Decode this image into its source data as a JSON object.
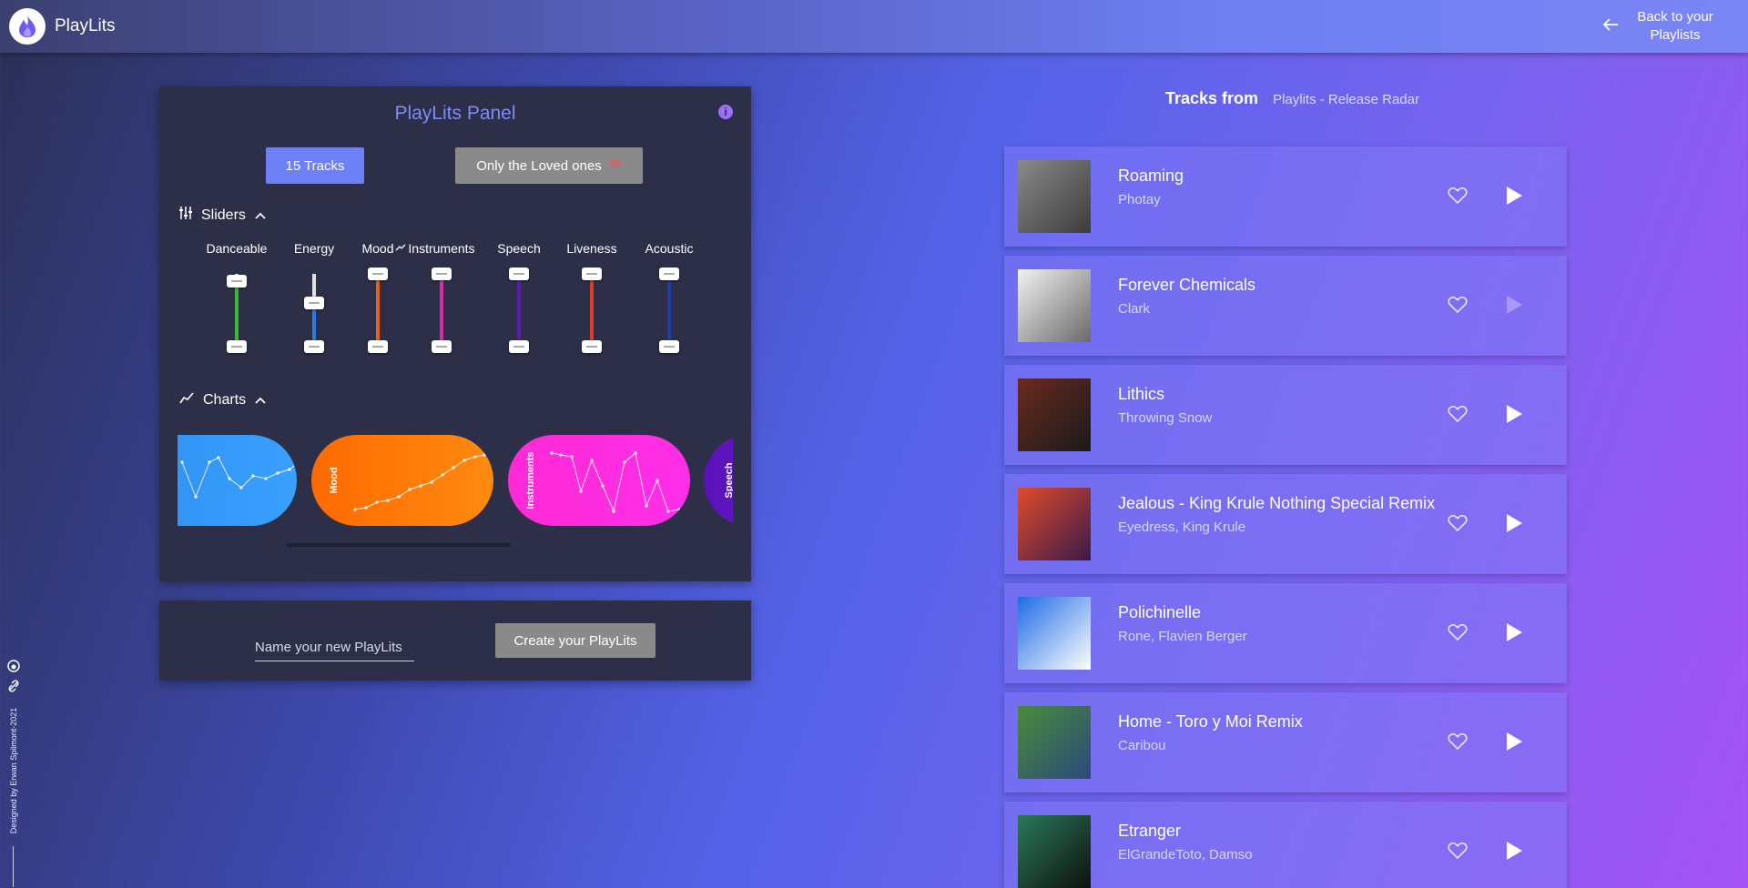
{
  "header": {
    "app_title": "PlayLits",
    "back_label_line1": "Back to your",
    "back_label_line2": "Playlists"
  },
  "panel": {
    "title": "PlayLits Panel",
    "tracks_button": "15 Tracks",
    "loved_button": "Only the Loved ones",
    "sliders_heading": "Sliders",
    "charts_heading": "Charts",
    "sliders": [
      {
        "label": "Danceable",
        "color": "#3dbb2f",
        "low": 0.0,
        "high": 0.9
      },
      {
        "label": "Energy",
        "color": "#2e7be6",
        "low": 0.0,
        "high": 0.6
      },
      {
        "label": "Mood",
        "color": "#e8641c",
        "low": 0.0,
        "high": 1.0
      },
      {
        "label": "Instruments",
        "color": "#d62ea4",
        "low": 0.0,
        "high": 1.0
      },
      {
        "label": "Speech",
        "color": "#5b1ab0",
        "low": 0.0,
        "high": 1.0
      },
      {
        "label": "Liveness",
        "color": "#e23a2a",
        "low": 0.0,
        "high": 1.0
      },
      {
        "label": "Acoustic",
        "color": "#1b3ea8",
        "low": 0.0,
        "high": 1.0
      }
    ],
    "charts": [
      {
        "label": "",
        "color_start": "#2d8ff0",
        "color_end": "#3aa0ff"
      },
      {
        "label": "Mood",
        "color_start": "#ff6a00",
        "color_end": "#ff8a10"
      },
      {
        "label": "Instruments",
        "color_start": "#ff2ad6",
        "color_end": "#ff2fe8"
      },
      {
        "label": "Speech",
        "color_start": "#5a12b8",
        "color_end": "#6a1ac8"
      }
    ]
  },
  "create": {
    "placeholder": "Name your new PlayLits",
    "button": "Create your PlayLits"
  },
  "credit": "Designed by Erwan Spilmont-2021",
  "tracks_section": {
    "from_label": "Tracks from",
    "playlist_name": "Playlits - Release Radar"
  },
  "tracks": [
    {
      "title": "Roaming",
      "artist": "Photay",
      "cover": [
        "#8a8a8a",
        "#3c3c3c"
      ],
      "playable": true
    },
    {
      "title": "Forever Chemicals",
      "artist": "Clark",
      "cover": [
        "#f2f2f2",
        "#6a6a6a"
      ],
      "playable": false
    },
    {
      "title": "Lithics",
      "artist": "Throwing Snow",
      "cover": [
        "#6a2a20",
        "#1a1a1a"
      ],
      "playable": true
    },
    {
      "title": "Jealous - King Krule Nothing Special Remix",
      "artist": "Eyedress, King Krule",
      "cover": [
        "#e04a2a",
        "#3a1a4a"
      ],
      "playable": true
    },
    {
      "title": "Polichinelle",
      "artist": "Rone, Flavien Berger",
      "cover": [
        "#1e6be6",
        "#ffffff"
      ],
      "playable": true
    },
    {
      "title": "Home - Toro y Moi Remix",
      "artist": "Caribou",
      "cover": [
        "#4a8a3a",
        "#2a4a7a"
      ],
      "playable": true
    },
    {
      "title": "Etranger",
      "artist": "ElGrandeToto, Damso",
      "cover": [
        "#2a7a5a",
        "#101010"
      ],
      "playable": true
    }
  ]
}
